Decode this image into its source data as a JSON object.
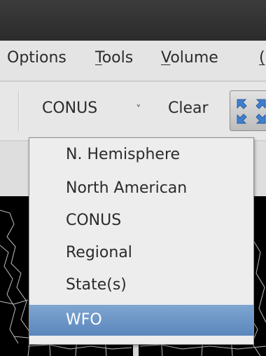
{
  "menubar": {
    "items": [
      {
        "label": "Options",
        "mnemonic_prefix": "",
        "mnemonic": "",
        "rest": "Options"
      },
      {
        "label": "Tools",
        "mnemonic_prefix": "",
        "mnemonic": "T",
        "rest": "ools"
      },
      {
        "label": "Volume",
        "mnemonic_prefix": "",
        "mnemonic": "V",
        "rest": "olume"
      },
      {
        "label": "(",
        "mnemonic_prefix": "",
        "mnemonic": "(",
        "rest": ""
      }
    ]
  },
  "toolbar": {
    "scale_value": "CONUS",
    "scale_chevron": "˅",
    "clear_label": "Clear",
    "zoom_icon": "expand-arrows-icon"
  },
  "scale_dropdown": {
    "options": [
      "N. Hemisphere",
      "North American",
      "CONUS",
      "Regional",
      "State(s)",
      "WFO"
    ],
    "highlighted": "WFO"
  },
  "colors": {
    "highlight": "#6a93c6",
    "map_background": "#000000",
    "map_lines": "#bfbfbf"
  }
}
